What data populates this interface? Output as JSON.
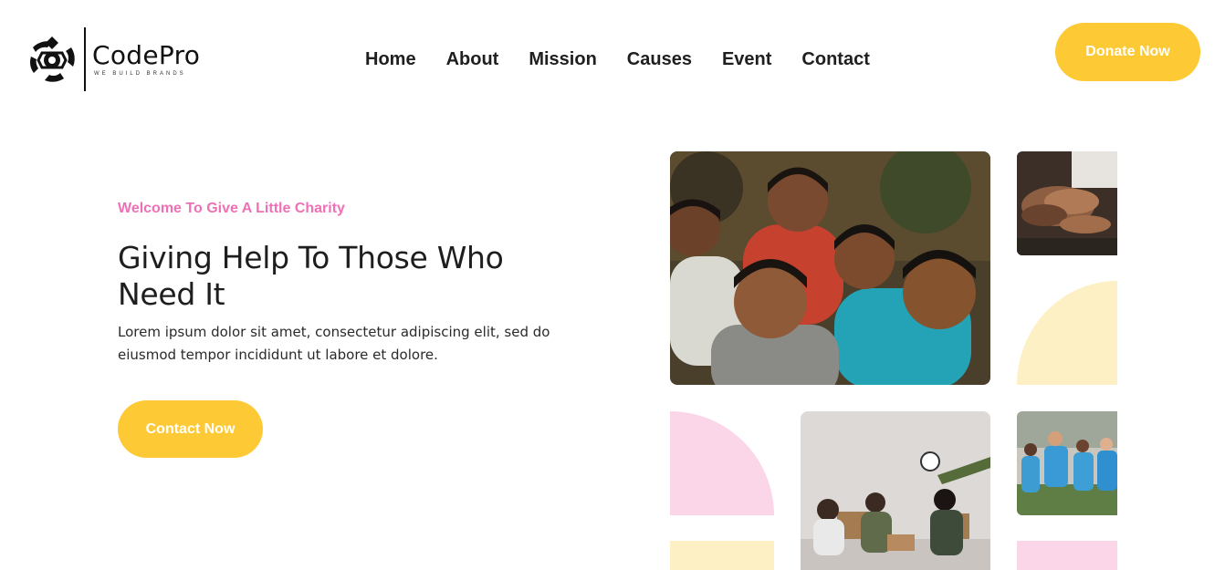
{
  "brand": {
    "name": "CodePro",
    "tagline": "WE BUILD BRANDS"
  },
  "nav": {
    "items": [
      "Home",
      "About",
      "Mission",
      "Causes",
      "Event",
      "Contact"
    ]
  },
  "header": {
    "donate_label": "Donate Now"
  },
  "hero": {
    "eyebrow": "Welcome To Give A Little Charity",
    "title": "Giving Help To Those Who Need It",
    "description": "Lorem ipsum dolor sit amet, consectetur adipiscing elit, sed do eiusmod tempor incididunt ut labore et dolore.",
    "contact_label": "Contact Now"
  },
  "gallery": {
    "images": [
      "children-photo",
      "joined-hands-photo",
      "volunteers-packing-photo",
      "volunteer-group-photo"
    ]
  },
  "colors": {
    "accent_yellow": "#fdc935",
    "eyebrow_pink": "#ef71b5",
    "pale_yellow": "#fcf0c4",
    "pale_pink": "#fbd5e8",
    "text_dark": "#212121"
  }
}
